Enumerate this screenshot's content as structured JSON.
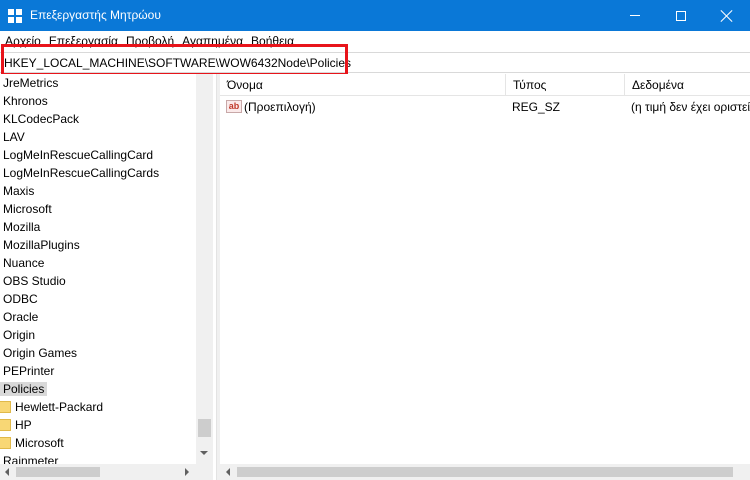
{
  "window": {
    "title": "Επεξεργαστής Μητρώου",
    "accent_color": "#0a78d7",
    "icon": "registry-editor-icon"
  },
  "menu": {
    "items": [
      "Αρχείο",
      "Επεξεργασία",
      "Προβολή",
      "Αγαπημένα",
      "Βοήθεια"
    ]
  },
  "address": {
    "path": "HKEY_LOCAL_MACHINE\\SOFTWARE\\WOW6432Node\\Policies",
    "highlight_color": "#e8141b"
  },
  "tree": {
    "items": [
      "JreMetrics",
      "Khronos",
      "KLCodecPack",
      "LAV",
      "LogMeInRescueCallingCard",
      "LogMeInRescueCallingCards",
      "Maxis",
      "Microsoft",
      "Mozilla",
      "MozillaPlugins",
      "Nuance",
      "OBS Studio",
      "ODBC",
      "Oracle",
      "Origin",
      "Origin Games",
      "PEPrinter",
      "Policies"
    ],
    "selected": "Policies",
    "children": [
      "Hewlett-Packard",
      "HP",
      "Microsoft"
    ],
    "after": "Rainmeter"
  },
  "list": {
    "columns": {
      "name": "Όνομα",
      "type": "Τύπος",
      "data": "Δεδομένα"
    },
    "rows": [
      {
        "icon": "string-value-icon",
        "icon_text": "ab",
        "name": "(Προεπιλογή)",
        "type": "REG_SZ",
        "data": "(η τιμή δεν έχει οριστεί)"
      }
    ]
  }
}
